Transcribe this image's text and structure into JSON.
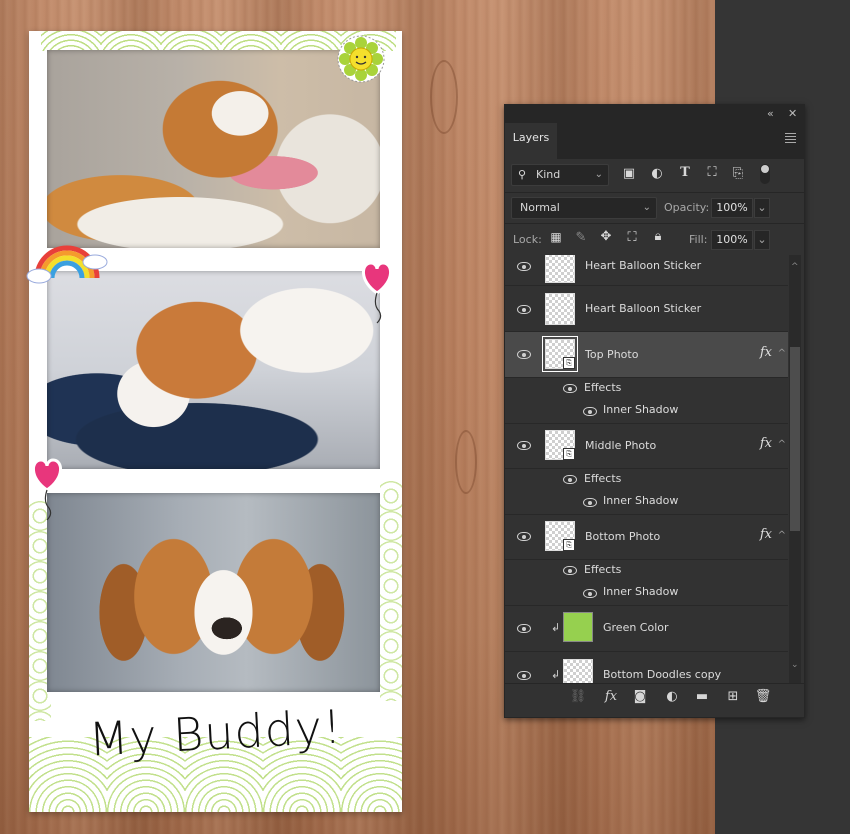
{
  "canvas": {
    "caption": "My Buddy!",
    "photos": [
      {
        "name": "Top Photo",
        "subject": "yawning beagle on couch"
      },
      {
        "name": "Middle Photo",
        "subject": "beagle resting on blue blanket"
      },
      {
        "name": "Bottom Photo",
        "subject": "beagle portrait"
      }
    ],
    "stickers": [
      "sun-flower-sticker",
      "rainbow-sticker",
      "heart-balloon-sticker",
      "heart-balloon-sticker"
    ],
    "colors": {
      "doodle_green": "#a8d35a",
      "wood": "#b9805f",
      "sticker_pink": "#e8367c"
    }
  },
  "panel": {
    "title": "Layers",
    "collapse_label": "«",
    "close_label": "✕",
    "filter": {
      "kind_label": "Kind",
      "icons": [
        "image-filter-icon",
        "adjustment-filter-icon",
        "type-filter-icon",
        "shape-filter-icon",
        "smart-object-filter-icon"
      ]
    },
    "blend_mode": "Normal",
    "opacity_label": "Opacity:",
    "opacity_value": "100%",
    "lock_label": "Lock:",
    "fill_label": "Fill:",
    "fill_value": "100%",
    "layers": [
      {
        "name": "Heart Balloon Sticker",
        "thumb": "transparent",
        "visible": true
      },
      {
        "name": "Heart Balloon Sticker",
        "thumb": "transparent",
        "visible": true
      },
      {
        "name": "Top Photo",
        "thumb": "smart-object",
        "visible": true,
        "selected": true,
        "fx": "fx",
        "effects_label": "Effects",
        "effect": "Inner Shadow"
      },
      {
        "name": "Middle Photo",
        "thumb": "smart-object",
        "visible": true,
        "fx": "fx",
        "effects_label": "Effects",
        "effect": "Inner Shadow"
      },
      {
        "name": "Bottom Photo",
        "thumb": "smart-object",
        "visible": true,
        "fx": "fx",
        "effects_label": "Effects",
        "effect": "Inner Shadow"
      },
      {
        "name": "Green Color",
        "thumb": "green-fill",
        "visible": true,
        "clipped": true,
        "color": "#96d04f"
      },
      {
        "name": "Bottom Doodles copy",
        "thumb": "transparent",
        "visible": true,
        "clipped": true
      }
    ],
    "footer_icons": [
      "link-layers-icon",
      "fx-icon",
      "add-mask-icon",
      "adjustment-layer-icon",
      "new-group-icon",
      "new-layer-icon",
      "delete-layer-icon"
    ]
  }
}
